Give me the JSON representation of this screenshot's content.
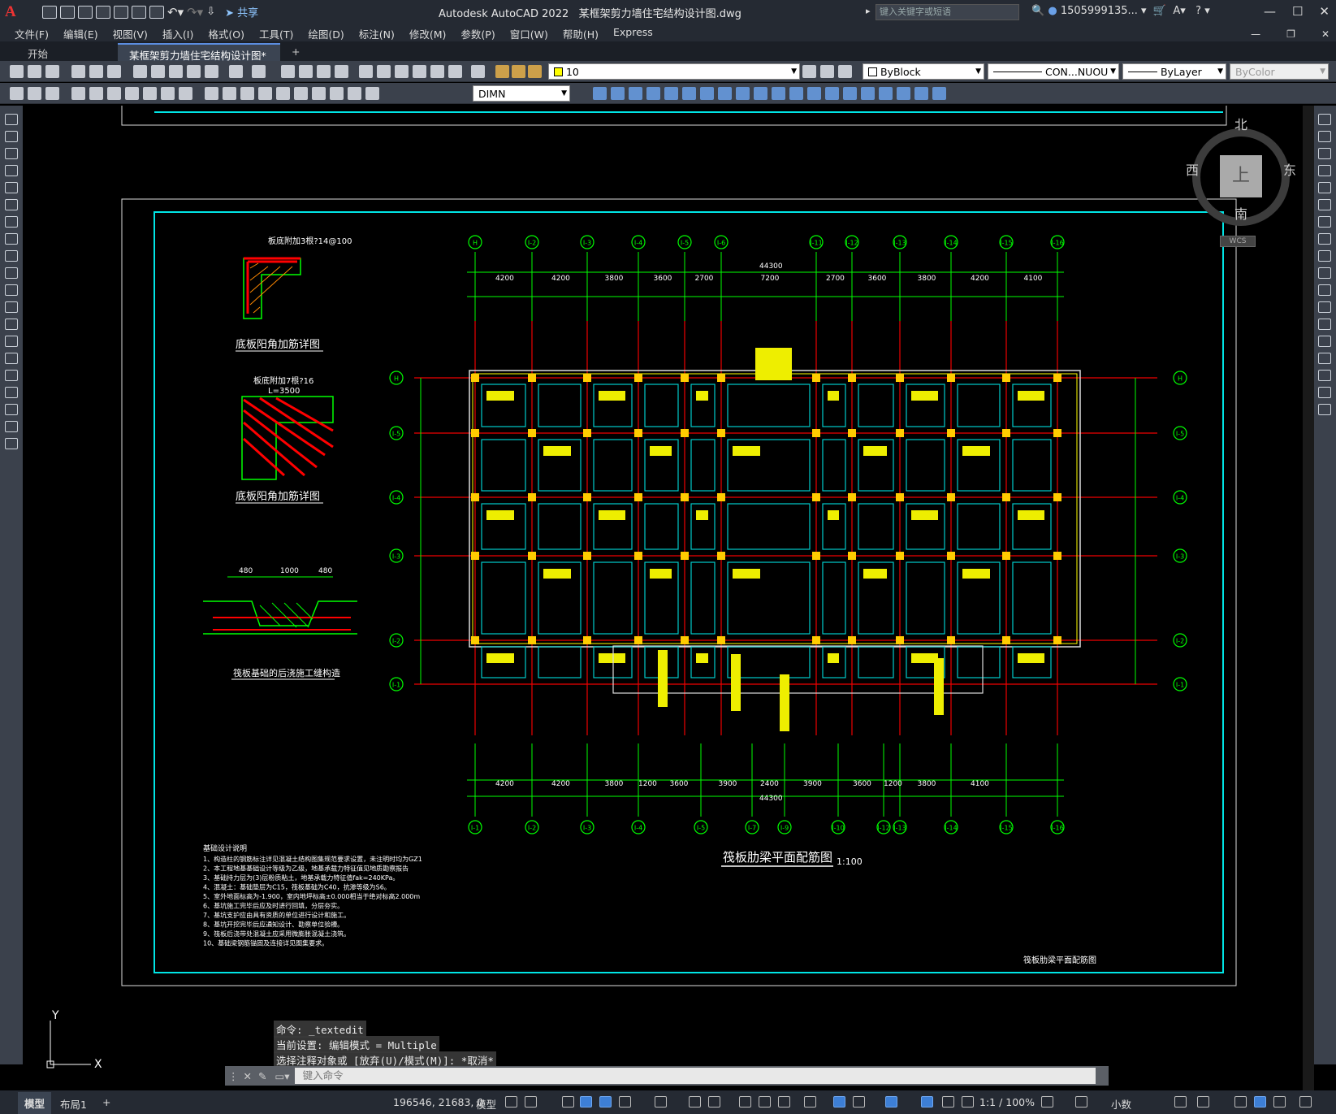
{
  "app": {
    "logo": "A",
    "title": "Autodesk AutoCAD 2022",
    "file": "某框架剪力墙住宅结构设计图.dwg",
    "share": "共享",
    "search_placeholder": "键入关键字或短语",
    "user": "1505999135...",
    "win_controls": [
      "—",
      "☐",
      "✕"
    ]
  },
  "menu": [
    "文件(F)",
    "编辑(E)",
    "视图(V)",
    "插入(I)",
    "格式(O)",
    "工具(T)",
    "绘图(D)",
    "标注(N)",
    "修改(M)",
    "参数(P)",
    "窗口(W)",
    "帮助(H)",
    "Express"
  ],
  "tabs": [
    {
      "label": "开始"
    },
    {
      "label": "某框架剪力墙住宅结构设计图*",
      "close": "✕"
    },
    {
      "label": "+"
    }
  ],
  "toolbar": {
    "layer_value": "10",
    "color": "ByBlock",
    "linetype": "CON...NUOU",
    "lineweight": "ByLayer",
    "plotstyle": "ByColor",
    "dimstyle": "DIMN"
  },
  "viewcube": {
    "north": "北",
    "south": "南",
    "west": "西",
    "east": "东",
    "face": "上",
    "wcs": "WCS"
  },
  "drawing": {
    "grid_top": [
      "H",
      "I-2",
      "I-3",
      "I-4",
      "I-5",
      "I-6",
      "I-11",
      "I-12",
      "I-13",
      "I-14",
      "I-15",
      "I-16"
    ],
    "grid_bottom": [
      "I-1",
      "I-2",
      "I-3",
      "I-4",
      "I-5",
      "I-7",
      "I-9",
      "I-10",
      "I-12",
      "I-13",
      "I-14",
      "I-15",
      "I-16"
    ],
    "grid_left": [
      "H",
      "I-5",
      "I-4",
      "I-3",
      "I-2",
      "I-1"
    ],
    "dims_top": [
      "4200",
      "4200",
      "3800",
      "3600",
      "2700",
      "7200",
      "2700",
      "3600",
      "3800",
      "4200",
      "4100"
    ],
    "dims_bottom": [
      "4200",
      "4200",
      "3800",
      "1200",
      "3600",
      "3900",
      "2400",
      "3900",
      "3600",
      "1200",
      "3800",
      "4100"
    ],
    "total_dim": "44300",
    "detail1_title": "底板阳角加筋详图",
    "detail1_note": "板底附加3根?14@100",
    "detail2_title": "底板阳角加筋详图",
    "detail2_note": "板底附加7根?16",
    "detail2_len": "L=3500",
    "detail3_title": "筏板基础的后浇施工缝构造",
    "detail3_dims": [
      "480",
      "1000",
      "480"
    ],
    "plan_title": "筏板肋梁平面配筋图",
    "plan_scale": "1:100",
    "titleblock": "筏板肋梁平面配筋图",
    "notes_title": "基础设计说明",
    "notes": [
      "1、构造柱的钢筋标注详见混凝土结构图集规范要求设置，未注明时均为GZ1",
      "2、本工程地基基础设计等级为乙级，地基承载力特征值见地质勘察报告",
      "3、基础持力层为(3)层粉质粘土，地基承载力特征值fak=240KPa。",
      "4、混凝土：基础垫层为C15，筏板基础为C40，抗渗等级为S6。",
      "5、室外地面标高为-1.900，室内地坪标高±0.000相当于绝对标高2.000m",
      "6、基坑施工完毕后应及时进行回填，分层夯实。",
      "7、基坑支护应由具有资质的单位进行设计和施工。",
      "8、基坑开挖完毕后应通知设计、勘察单位验槽。",
      "9、筏板后浇带处混凝土应采用微膨胀混凝土浇筑。",
      "10、基础梁钢筋锚固及连接详见图集要求。"
    ]
  },
  "command": {
    "history": [
      "命令: _textedit",
      "当前设置: 编辑模式 = Multiple",
      "选择注释对象或 [放弃(U)/模式(M)]: *取消*"
    ],
    "placeholder": "键入命令"
  },
  "status": {
    "layout_tabs": [
      "模型",
      "布局1",
      "+"
    ],
    "coords": "196546, 21683, 0",
    "space": "模型",
    "scale": "1:1 / 100%",
    "units": "小数"
  },
  "ucs": {
    "x": "X",
    "y": "Y"
  }
}
